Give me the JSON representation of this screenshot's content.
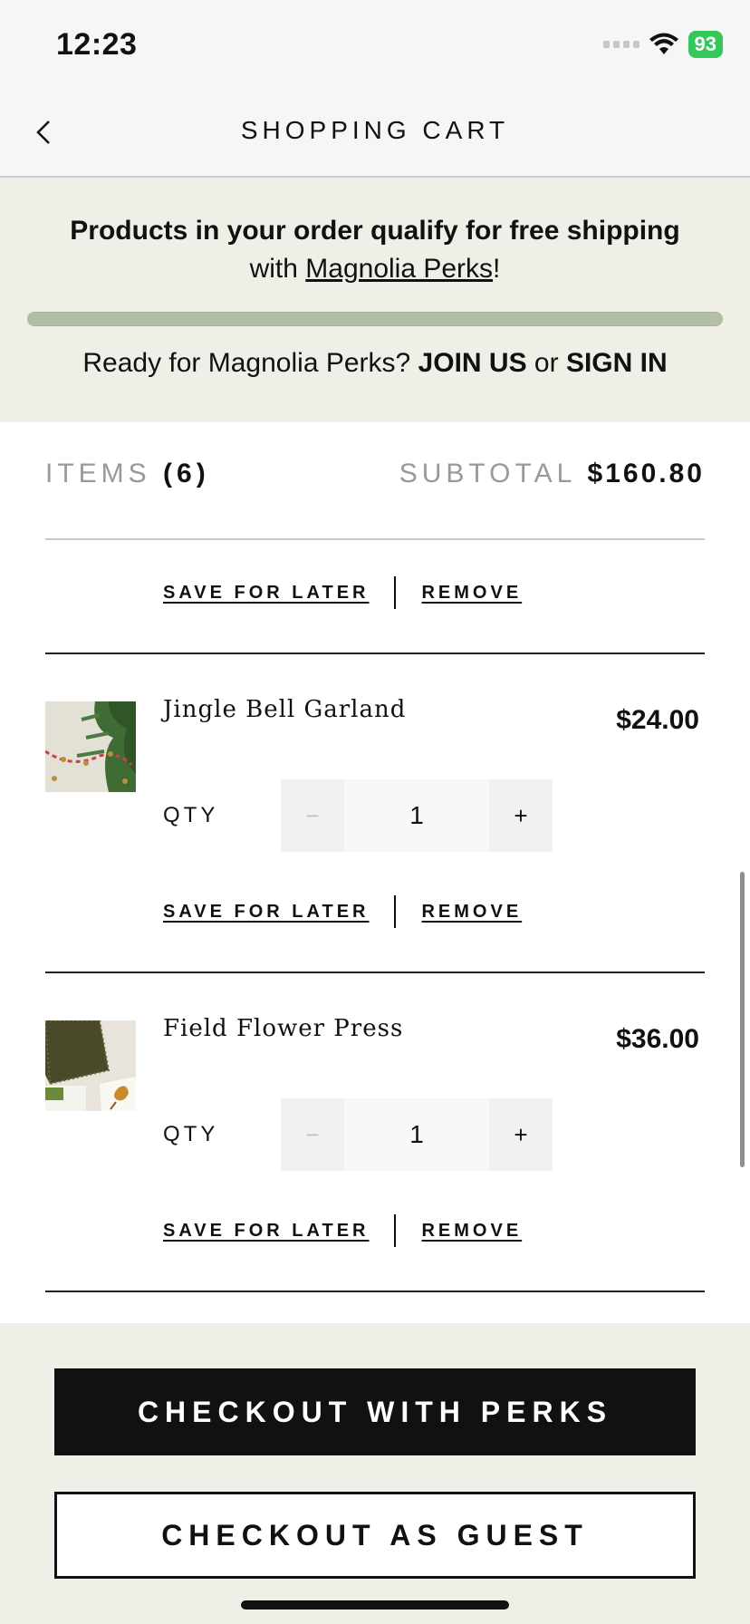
{
  "status_bar": {
    "time": "12:23",
    "battery": "93"
  },
  "nav": {
    "title": "SHOPPING CART"
  },
  "banner": {
    "line1": "Products in your order qualify for free shipping",
    "line2_prefix": "with ",
    "line2_link": "Magnolia Perks",
    "line2_suffix": "!",
    "progress_fraction": 1.0,
    "line3_prefix": "Ready for Magnolia Perks? ",
    "join": "JOIN US",
    "or": " or ",
    "signin": "SIGN IN"
  },
  "summary": {
    "items_label": "ITEMS",
    "items_count": "(6)",
    "subtotal_label": "SUBTOTAL",
    "subtotal_value": "$160.80"
  },
  "actions": {
    "save_label": "SAVE FOR LATER",
    "remove_label": "REMOVE"
  },
  "qty_label": "QTY",
  "items": [
    {
      "name": "Jingle Bell Garland",
      "price": "$24.00",
      "qty": "1"
    },
    {
      "name": "Field Flower Press",
      "price": "$36.00",
      "qty": "1"
    }
  ],
  "stepper": {
    "minus": "−",
    "plus": "+"
  },
  "footer": {
    "checkout_perks": "CHECKOUT WITH PERKS",
    "checkout_guest": "CHECKOUT AS GUEST"
  },
  "colors": {
    "banner_bg": "#f0efe7",
    "progress": "#b2bfa3",
    "battery": "#34c759"
  }
}
